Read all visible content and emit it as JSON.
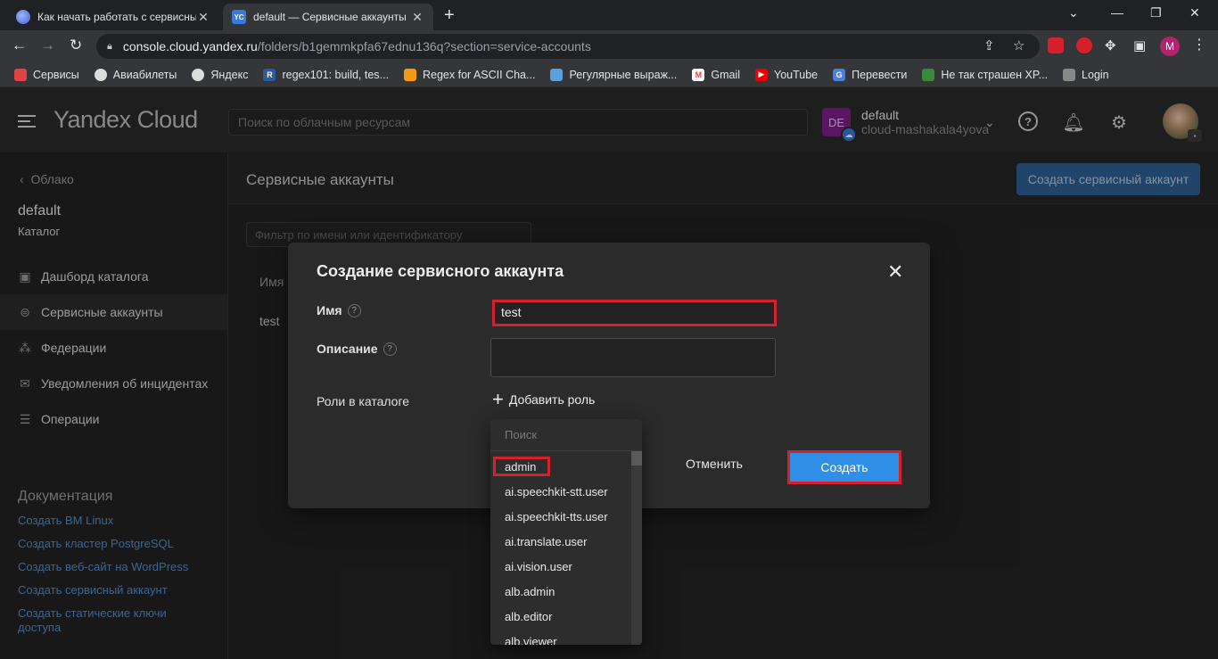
{
  "browser": {
    "tabs": [
      {
        "title": "Как начать работать с сервисными",
        "active": false
      },
      {
        "title": "default — Сервисные аккаунты",
        "active": true
      }
    ],
    "url_host": "console.cloud.yandex.ru",
    "url_path": "/folders/b1gemmkpfa67ednu136q?section=service-accounts",
    "profile_initial": "M",
    "bookmarks": [
      "Сервисы",
      "Авиабилеты",
      "Яндекс",
      "regex101: build, tes...",
      "Regex for ASCII Cha...",
      "Регулярные выраж...",
      "Gmail",
      "YouTube",
      "Перевести",
      "Не так страшен XP...",
      "Login"
    ]
  },
  "header": {
    "logo": "Yandex Cloud",
    "search_placeholder": "Поиск по облачным ресурсам",
    "context_initials": "DE",
    "context_name": "default",
    "context_cloud": "cloud-mashakala4yova"
  },
  "sidebar": {
    "back_label": "Облако",
    "folder_name": "default",
    "folder_type": "Каталог",
    "items": [
      {
        "label": "Дашборд каталога",
        "icon": "dashboard-icon"
      },
      {
        "label": "Сервисные аккаунты",
        "icon": "robot-icon",
        "active": true
      },
      {
        "label": "Федерации",
        "icon": "federation-icon"
      },
      {
        "label": "Уведомления об инцидентах",
        "icon": "envelope-icon"
      },
      {
        "label": "Операции",
        "icon": "operations-list-icon"
      }
    ],
    "docs_title": "Документация",
    "docs_links": [
      "Создать ВМ Linux",
      "Создать кластер PostgreSQL",
      "Создать веб-сайт на WordPress",
      "Создать сервисный аккаунт",
      "Создать статические ключи доступа"
    ]
  },
  "main": {
    "title": "Сервисные аккаунты",
    "create_button": "Создать сервисный аккаунт",
    "filter_placeholder": "Фильтр по имени или идентификатору",
    "column_name": "Имя",
    "rows": [
      "test"
    ]
  },
  "modal": {
    "title": "Создание сервисного аккаунта",
    "name_label": "Имя",
    "name_value": "test",
    "description_label": "Описание",
    "roles_label": "Роли в каталоге",
    "add_role": "Добавить роль",
    "cancel": "Отменить",
    "create": "Создать"
  },
  "role_dropdown": {
    "search_placeholder": "Поиск",
    "roles": [
      "admin",
      "ai.speechkit-stt.user",
      "ai.speechkit-tts.user",
      "ai.translate.user",
      "ai.vision.user",
      "alb.admin",
      "alb.editor",
      "alb.viewer"
    ]
  },
  "colors": {
    "accent": "#2f8ee6",
    "highlight": "#d6202c",
    "link": "#4b8fd6"
  }
}
